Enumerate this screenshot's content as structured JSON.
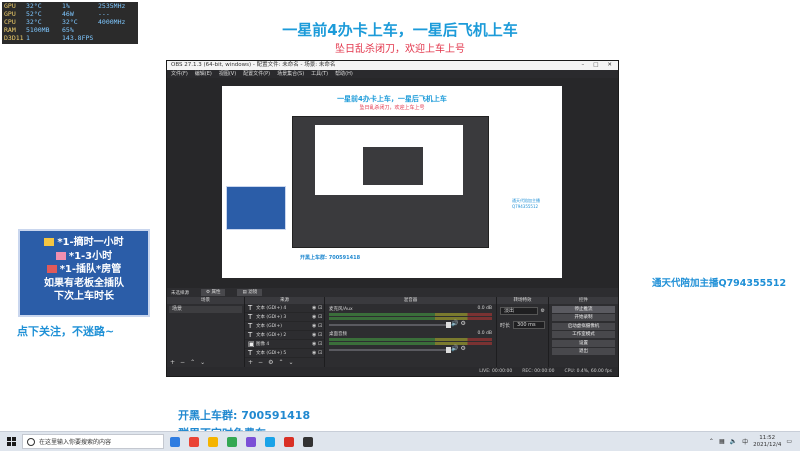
{
  "hardware_monitor": {
    "rows": [
      {
        "key": "GPU",
        "c1": "32°C",
        "c2": "1%",
        "c3": "2535MHz"
      },
      {
        "key": "GPU",
        "c1": "52°C",
        "c2": "46W",
        "c3": "---"
      },
      {
        "key": "CPU",
        "c1": "32°C",
        "c2": "32°C",
        "c3": "4000MHz"
      },
      {
        "key": "RAM",
        "c1": "5100MB",
        "c2": "65%",
        "c3": ""
      },
      {
        "key": "D3D11",
        "c1": "1",
        "c2": "143.8FPS",
        "c3": ""
      }
    ]
  },
  "overlay": {
    "title": "一星前4办卡上车，一星后飞机上车",
    "subtitle": "坠日乱杀闭刀，欢迎上车上号",
    "notice_lines": [
      "*1-摘时一小时",
      "*1-3小时",
      "*1-插队*房管",
      "如果有老板全插队",
      "下次上车时长"
    ],
    "follow": "点下关注，不迷路~",
    "promo": "通天代陪加主播Q794355512",
    "group_line1": "开黑上车群: 700591418",
    "group_line2": "群里不定时免费车"
  },
  "obs": {
    "window_title": "OBS 27.1.3 (64-bit, windows) - 配置文件: 未命名 - 场景: 未命名",
    "menu": [
      "文件(F)",
      "编辑(E)",
      "视图(V)",
      "配置文件(P)",
      "场景集合(S)",
      "工具(T)",
      "帮助(H)"
    ],
    "context_bar": {
      "no_source": "未选择源",
      "properties": "属性",
      "filters": "滤镜"
    },
    "scenes": {
      "header": "场景",
      "items": [
        "场景"
      ]
    },
    "sources": {
      "header": "来源",
      "items": [
        {
          "icon": "T",
          "name": "文本 (GDI+) 4"
        },
        {
          "icon": "T",
          "name": "文本 (GDI+) 3"
        },
        {
          "icon": "T",
          "name": "文本 (GDI+)"
        },
        {
          "icon": "T",
          "name": "文本 (GDI+) 2"
        },
        {
          "icon": "▣",
          "name": "图像 4"
        },
        {
          "icon": "T",
          "name": "文本 (GDI+) 5"
        }
      ]
    },
    "mixer": {
      "header": "混音器",
      "channels": [
        {
          "name": "麦克风/Aux",
          "db": "0.0 dB"
        },
        {
          "name": "桌面音频",
          "db": "0.0 dB"
        }
      ]
    },
    "transitions": {
      "header": "转场特效",
      "type": "淡出",
      "duration_label": "时长",
      "duration": "300 ms"
    },
    "controls": {
      "header": "控件",
      "buttons": [
        "停止推流",
        "开始录制",
        "启动虚拟摄像机",
        "工作室模式",
        "设置",
        "退出"
      ]
    },
    "status": {
      "live": "LIVE: 00:00:00",
      "rec": "REC: 00:00:00",
      "cpu": "CPU: 0.4%, 60.00 fps"
    }
  },
  "taskbar": {
    "search_placeholder": "在这里输入你要搜索的内容",
    "time": "11:52",
    "date": "2021/12/4",
    "apps": [
      "#2f7de1",
      "#ea4335",
      "#f5b400",
      "#34a853",
      "#7b4fd6",
      "#1aa3e8",
      "#d93025",
      "#333333"
    ]
  },
  "colors": {
    "accent_blue": "#1c9bd9",
    "accent_red": "#e2344a",
    "obs_bg": "#3a3a3d"
  }
}
